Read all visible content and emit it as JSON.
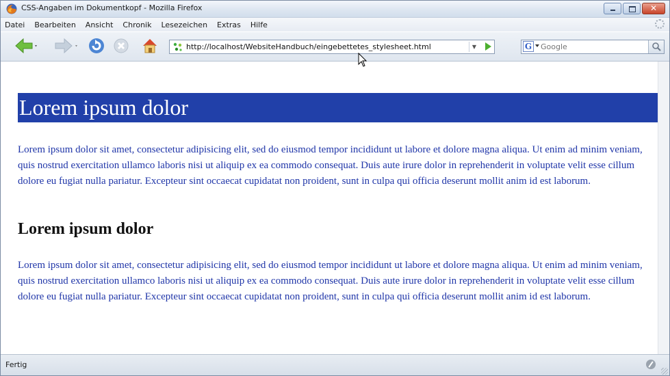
{
  "window": {
    "title": "CSS-Angaben im Dokumentkopf - Mozilla Firefox"
  },
  "menubar": {
    "items": [
      "Datei",
      "Bearbeiten",
      "Ansicht",
      "Chronik",
      "Lesezeichen",
      "Extras",
      "Hilfe"
    ]
  },
  "navbar": {
    "url": "http://localhost/WebsiteHandbuch/eingebettetes_stylesheet.html",
    "search_placeholder": "Google",
    "search_engine_letter": "G"
  },
  "content": {
    "heading1": "Lorem ipsum dolor",
    "paragraph1": "Lorem ipsum dolor sit amet, consectetur adipisicing elit, sed do eiusmod tempor incididunt ut labore et dolore magna aliqua. Ut enim ad minim veniam, quis nostrud exercitation ullamco laboris nisi ut aliquip ex ea commodo consequat. Duis aute irure dolor in reprehenderit in voluptate velit esse cillum dolore eu fugiat nulla pariatur. Excepteur sint occaecat cupidatat non proident, sunt in culpa qui officia deserunt mollit anim id est laborum.",
    "heading2": "Lorem ipsum dolor",
    "paragraph2": "Lorem ipsum dolor sit amet, consectetur adipisicing elit, sed do eiusmod tempor incididunt ut labore et dolore magna aliqua. Ut enim ad minim veniam, quis nostrud exercitation ullamco laboris nisi ut aliquip ex ea commodo consequat. Duis aute irure dolor in reprehenderit in voluptate velit esse cillum dolore eu fugiat nulla pariatur. Excepteur sint occaecat cupidatat non proident, sunt in culpa qui officia deserunt mollit anim id est laborum."
  },
  "statusbar": {
    "text": "Fertig"
  },
  "colors": {
    "heading_background": "#2140a9",
    "paragraph_text": "#1f35a8",
    "heading1_text": "#ffffff"
  }
}
